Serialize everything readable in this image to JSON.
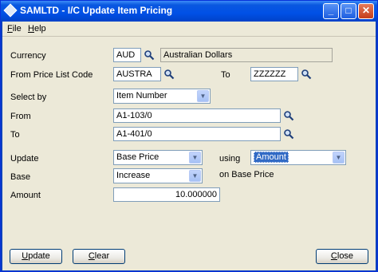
{
  "window": {
    "title": "SAMLTD - I/C Update Item Pricing",
    "minimize": "_",
    "maximize": "□",
    "close": "✕"
  },
  "menu": {
    "file": {
      "first": "F",
      "rest": "ile"
    },
    "help": {
      "first": "H",
      "rest": "elp"
    }
  },
  "form": {
    "currency_label": "Currency",
    "currency_code": "AUD",
    "currency_desc": "Australian Dollars",
    "from_price_list_label": "From Price List Code",
    "from_price_list_value": "AUSTRA",
    "to_label_1": "To",
    "to_price_list_value": "ZZZZZZ",
    "select_by_label": "Select by",
    "select_by_value": "Item Number",
    "from_label": "From",
    "from_value": "A1-103/0",
    "to_label_2": "To",
    "to_value": "A1-401/0",
    "update_label": "Update",
    "update_value": "Base Price",
    "using_label": "using",
    "using_value": "Amount",
    "base_label": "Base",
    "base_value": "Increase",
    "on_base_price_label": "on Base Price",
    "amount_label": "Amount",
    "amount_value": "10.000000"
  },
  "buttons": {
    "update": {
      "first": "U",
      "rest": "pdate"
    },
    "clear": {
      "first": "C",
      "rest": "lear"
    },
    "close": {
      "first": "C",
      "rest": "lose"
    }
  },
  "icons": {
    "finder": "magnifier-icon",
    "dropdown": "chevron-down-icon"
  }
}
